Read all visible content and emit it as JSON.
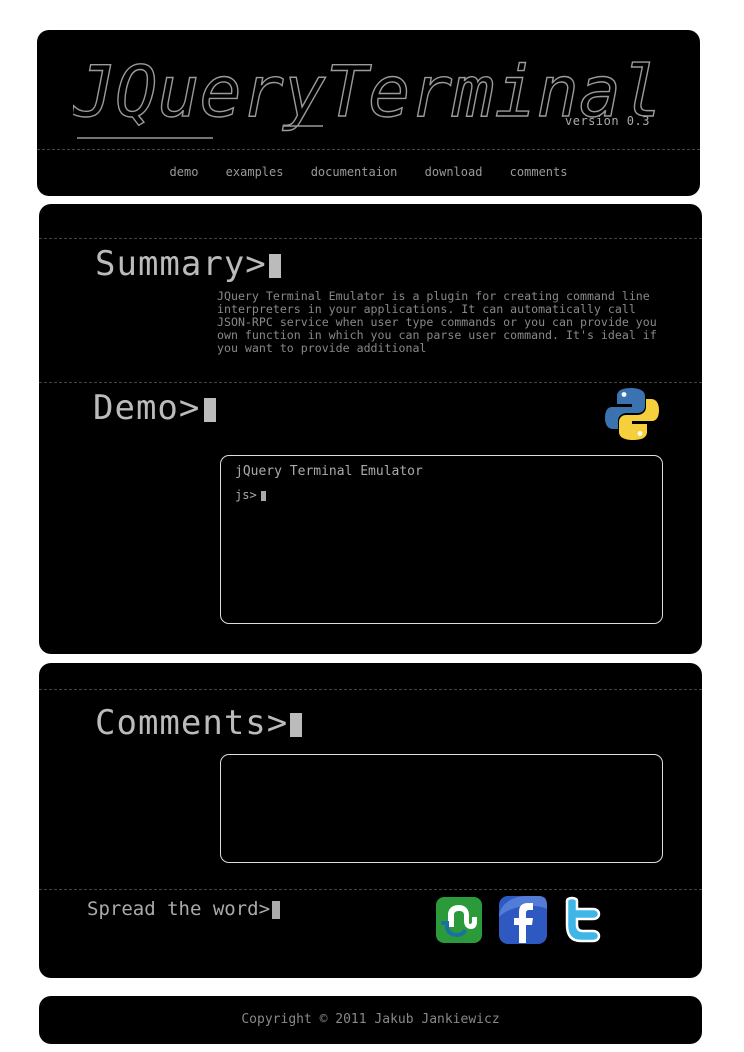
{
  "header": {
    "logo_text": "JQueryTerminal",
    "version": "version 0.3",
    "nav": [
      {
        "label": "demo"
      },
      {
        "label": "examples"
      },
      {
        "label": "documentaion"
      },
      {
        "label": "download"
      },
      {
        "label": "comments"
      }
    ]
  },
  "summary": {
    "heading": "Summary>",
    "text": "JQuery Terminal Emulator is a plugin for creating command line interpreters in your applications. It can automatically call JSON-RPC service when user type commands or you can provide you own function in which you can parse user command. It's ideal if you want to provide additional"
  },
  "demo": {
    "heading": "Demo>",
    "python_icon": "python-logo-icon",
    "terminal_greeting": "jQuery Terminal Emulator",
    "terminal_prompt": "js>"
  },
  "comments": {
    "heading": "Comments>",
    "spread": "Spread the word>",
    "social": [
      {
        "icon": "stumbleupon-icon",
        "color": "#2a9a3a"
      },
      {
        "icon": "facebook-icon",
        "color": "#2d59c1"
      },
      {
        "icon": "twitter-icon",
        "color": "#3fb6e8"
      }
    ]
  },
  "footer": {
    "copyright": "Copyright © 2011 Jakub Jankiewicz"
  }
}
